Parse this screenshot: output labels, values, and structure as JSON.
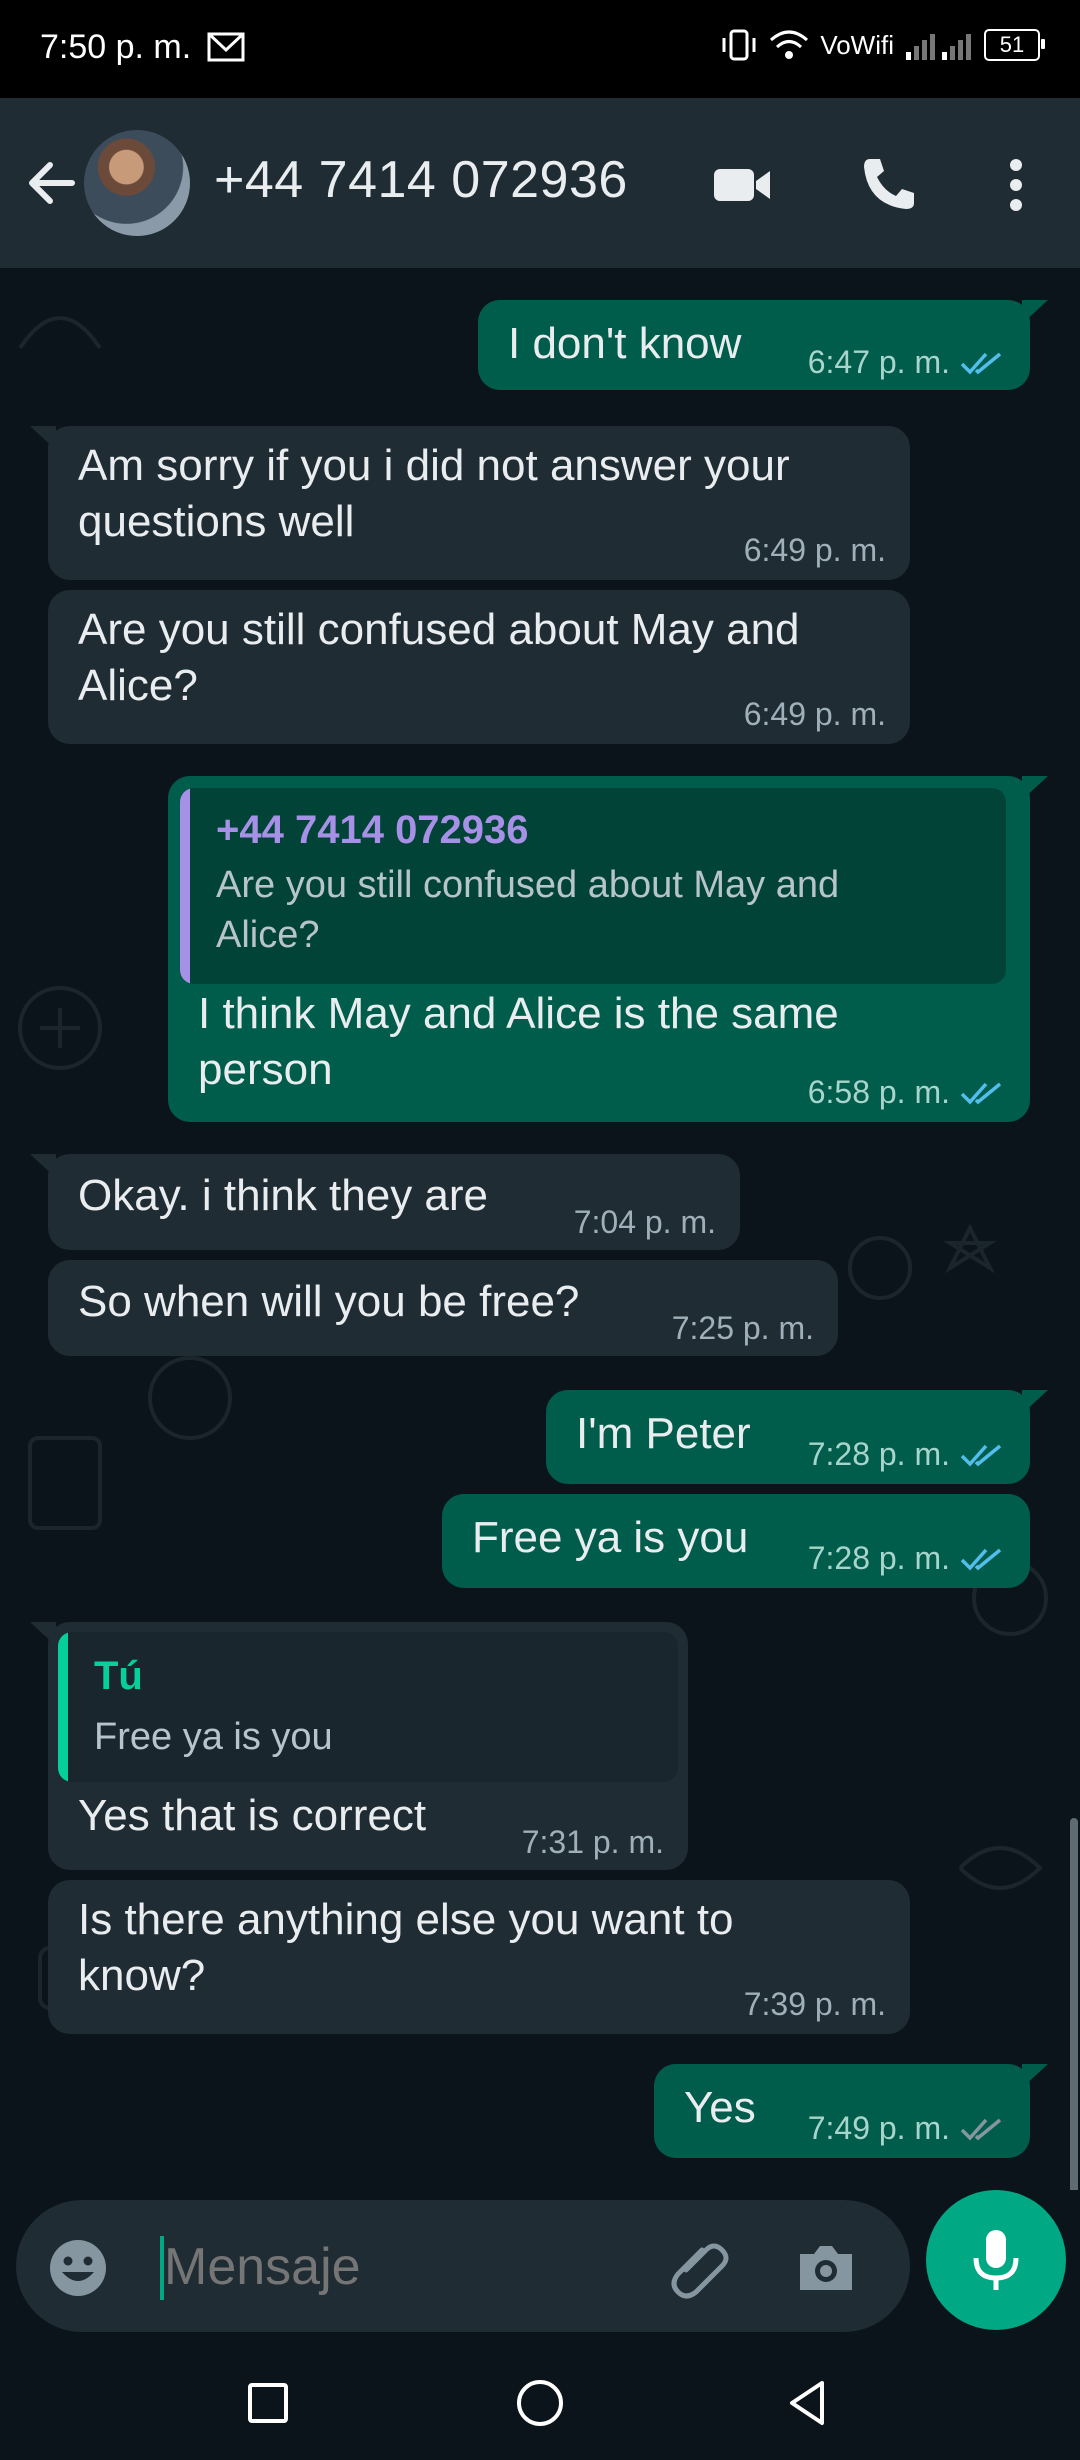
{
  "status_bar": {
    "time": "7:50 p. m.",
    "network": "VoWifi",
    "battery": "51"
  },
  "header": {
    "contact": "+44 7414 072936"
  },
  "messages": [
    {
      "dir": "out",
      "text": "I don't know",
      "time": "6:47 p. m.",
      "status": "read"
    },
    {
      "dir": "in",
      "text": "Am sorry if you i did not answer your\nquestions well",
      "time": "6:49 p. m."
    },
    {
      "dir": "in",
      "text": "Are you still confused about May and\nAlice?",
      "time": "6:49 p. m."
    },
    {
      "dir": "out",
      "quote_author": "+44 7414 072936",
      "quote_text": "Are you still confused about May and\nAlice?",
      "text": "I think May and Alice is the same\nperson",
      "time": "6:58 p. m.",
      "status": "read"
    },
    {
      "dir": "in",
      "text": "Okay. i think they are",
      "time": "7:04 p. m."
    },
    {
      "dir": "in",
      "text": "So when will you be free?",
      "time": "7:25 p. m."
    },
    {
      "dir": "out",
      "text": "I'm Peter",
      "time": "7:28 p. m.",
      "status": "read"
    },
    {
      "dir": "out",
      "text": "Free ya is you",
      "time": "7:28 p. m.",
      "status": "read"
    },
    {
      "dir": "in",
      "quote_author": "Tú",
      "quote_text": "Free ya is you",
      "text": "Yes that is correct",
      "time": "7:31 p. m."
    },
    {
      "dir": "in",
      "text": "Is there anything else you want to\nknow?",
      "time": "7:39 p. m."
    },
    {
      "dir": "out",
      "text": "Yes",
      "time": "7:49 p. m.",
      "status": "delivered"
    }
  ],
  "composer": {
    "placeholder": "Mensaje"
  },
  "colors": {
    "read_tick": "#53bdeb",
    "delivered_tick": "#8696a0",
    "accent": "#00a884",
    "quote_contact": "#a791e6",
    "quote_self": "#06cf9c"
  }
}
